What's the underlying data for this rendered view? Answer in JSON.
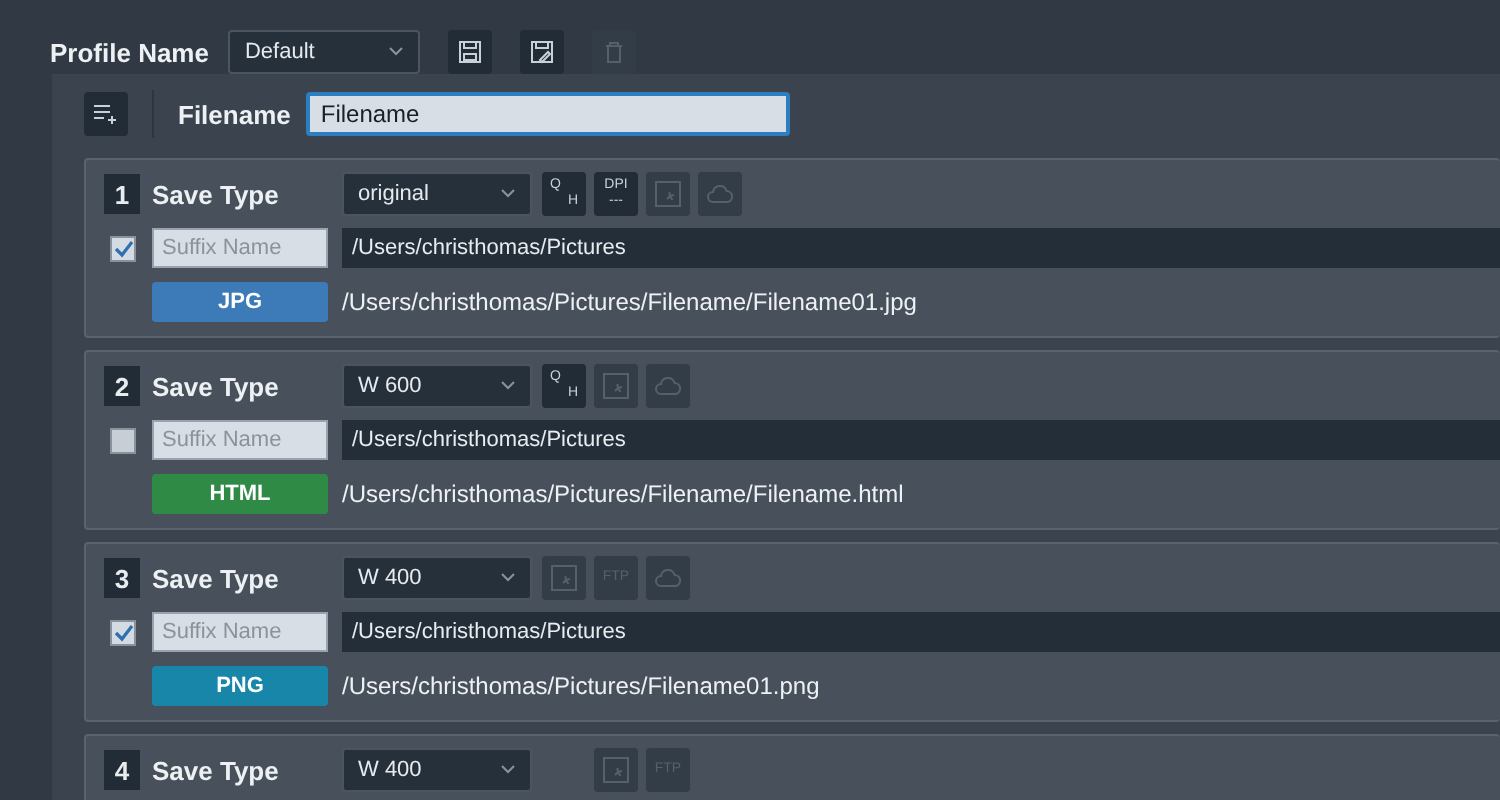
{
  "profile": {
    "label": "Profile Name",
    "value": "Default",
    "actions": [
      {
        "kind": "save",
        "disabled": false
      },
      {
        "kind": "save-as",
        "disabled": false
      },
      {
        "kind": "delete",
        "disabled": true
      }
    ]
  },
  "filename": {
    "label": "Filename",
    "value": "Filename"
  },
  "outputs": [
    {
      "number": "1",
      "label": "Save Type",
      "size": "original",
      "tools": [
        {
          "kind": "quality",
          "top": "Q",
          "bottom": "H",
          "disabled": false
        },
        {
          "kind": "dpi",
          "top": "DPI",
          "bottom": "---",
          "disabled": false
        },
        {
          "kind": "watermark",
          "disabled": true
        },
        {
          "kind": "cloud",
          "disabled": true
        }
      ],
      "checked": true,
      "suffix_placeholder": "Suffix Name",
      "folder": "/Users/christhomas/Pictures",
      "format": "JPG",
      "color": "#3d7ab8",
      "result": "/Users/christhomas/Pictures/Filename/Filename01.jpg"
    },
    {
      "number": "2",
      "label": "Save Type",
      "size": "W 600",
      "tools": [
        {
          "kind": "quality",
          "top": "Q",
          "bottom": "H",
          "disabled": false
        },
        {
          "kind": "watermark",
          "disabled": true
        },
        {
          "kind": "cloud",
          "disabled": true
        }
      ],
      "checked": false,
      "suffix_placeholder": "Suffix Name",
      "folder": "/Users/christhomas/Pictures",
      "format": "HTML",
      "color": "#2f8a45",
      "result": "/Users/christhomas/Pictures/Filename/Filename.html"
    },
    {
      "number": "3",
      "label": "Save Type",
      "size": "W 400",
      "tools": [
        {
          "kind": "watermark",
          "disabled": true
        },
        {
          "kind": "ftp",
          "top": "FTP",
          "disabled": true
        },
        {
          "kind": "cloud",
          "disabled": true
        }
      ],
      "checked": true,
      "suffix_placeholder": "Suffix Name",
      "folder": "/Users/christhomas/Pictures",
      "format": "PNG",
      "color": "#1786a8",
      "result": "/Users/christhomas/Pictures/Filename01.png"
    },
    {
      "number": "4",
      "label": "Save Type",
      "size": "W 400",
      "tools": [
        {
          "kind": "spacer"
        },
        {
          "kind": "watermark",
          "disabled": true
        },
        {
          "kind": "ftp",
          "top": "FTP",
          "disabled": true
        }
      ]
    }
  ]
}
